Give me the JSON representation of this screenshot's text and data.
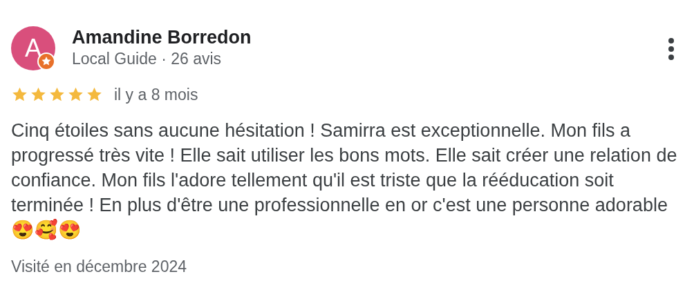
{
  "review": {
    "avatar_letter": "A",
    "local_guide_badge": true,
    "author": "Amandine Borredon",
    "author_info": "Local Guide · 26 avis",
    "stars": 5,
    "time": "il y a 8 mois",
    "text": "Cinq étoiles sans aucune hésitation ! Samirra est exceptionnelle. Mon fils a progressé très vite ! Elle sait utiliser les bons mots. Elle sait créer une relation de confiance. Mon fils l'adore tellement qu'il est triste que la rééducation soit terminée ! En plus d'être une professionnelle en or c'est une personne adorable 😍🥰😍",
    "visit": "Visité en décembre 2024"
  }
}
